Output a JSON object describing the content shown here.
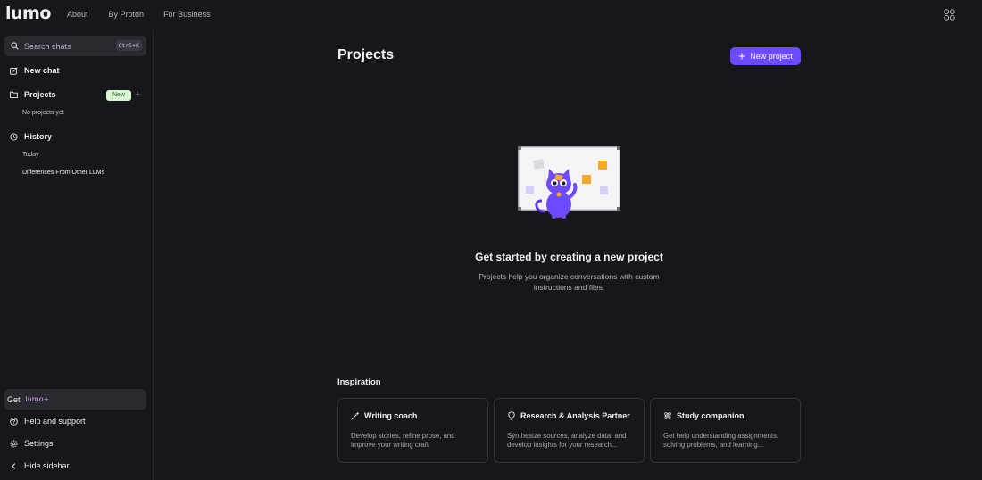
{
  "topbar": {
    "logo": "lumo",
    "nav": [
      "About",
      "By Proton",
      "For Business"
    ],
    "apps_icon": "grid-apps-icon"
  },
  "sidebar": {
    "search_placeholder": "Search chats",
    "search_shortcut": "Ctrl+K",
    "new_chat": "New chat",
    "projects_label": "Projects",
    "projects_badge": "New",
    "projects_empty": "No projects yet",
    "history_label": "History",
    "history_group": "Today",
    "history_items": [
      "Differences From Other LLMs"
    ],
    "get_label": "Get",
    "get_brand": "lumo+",
    "help": "Help and support",
    "settings": "Settings",
    "hide_sidebar": "Hide sidebar"
  },
  "main": {
    "title": "Projects",
    "new_project_button": "New project",
    "empty_title": "Get started by creating a new project",
    "empty_desc": "Projects help you organize conversations with custom instructions and files.",
    "inspiration_title": "Inspiration",
    "cards": [
      {
        "icon": "magic-wand-icon",
        "title": "Writing coach",
        "body": "Develop stories, refine prose, and improve your writing craft"
      },
      {
        "icon": "lightbulb-icon",
        "title": "Research & Analysis Partner",
        "body": "Synthesize sources, analyze data, and develop insights for your research..."
      },
      {
        "icon": "atom-icon",
        "title": "Study companion",
        "body": "Get help understanding assignments, solving problems, and learning..."
      }
    ]
  },
  "colors": {
    "background": "#17161a",
    "accent": "#6d4aff",
    "badge_bg": "#d9f3d3",
    "panel": "#2a2930"
  }
}
